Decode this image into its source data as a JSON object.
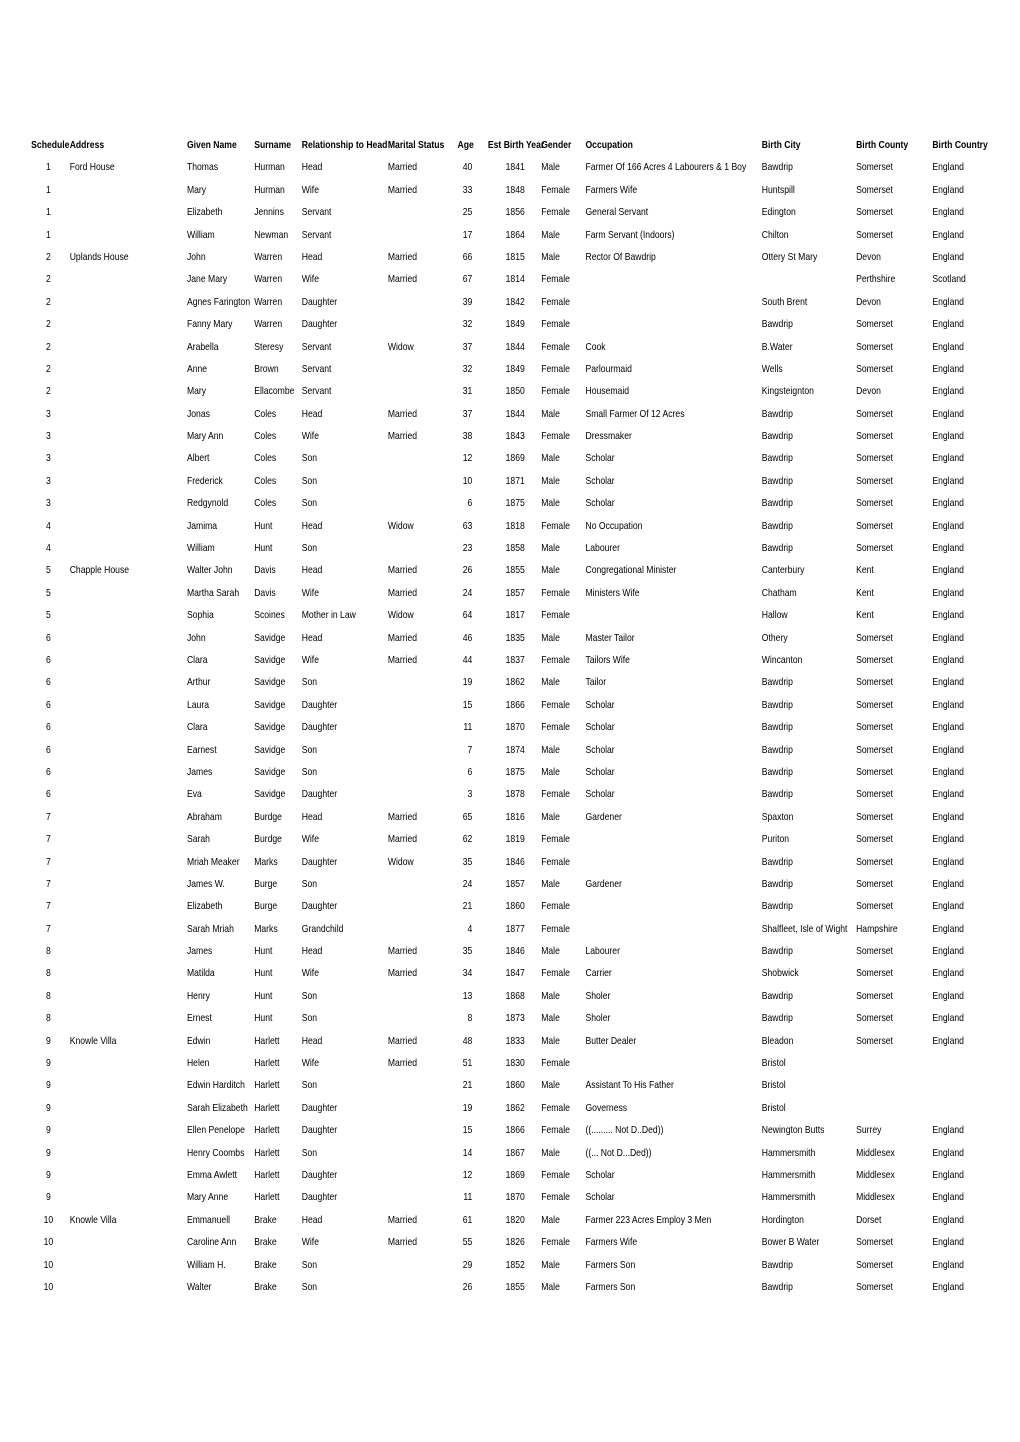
{
  "table": {
    "headers": [
      "Schedule",
      "Address",
      "Given Name",
      "Surname",
      "Relationship to Head",
      "Marital Status",
      "Age",
      "Est Birth Year",
      "Gender",
      "Occupation",
      "Birth City",
      "Birth County",
      "Birth Country"
    ],
    "rows": [
      [
        "1",
        "Ford House",
        "Thomas",
        "Hurman",
        "Head",
        "Married",
        "40",
        "1841",
        "Male",
        "Farmer Of 166 Acres 4 Labourers & 1 Boy",
        "Bawdrip",
        "Somerset",
        "England"
      ],
      [
        "1",
        "",
        "Mary",
        "Hurman",
        "Wife",
        "Married",
        "33",
        "1848",
        "Female",
        "Farmers Wife",
        "Huntspill",
        "Somerset",
        "England"
      ],
      [
        "1",
        "",
        "Elizabeth",
        "Jennins",
        "Servant",
        "",
        "25",
        "1856",
        "Female",
        "General Servant",
        "Edington",
        "Somerset",
        "England"
      ],
      [
        "1",
        "",
        "William",
        "Newman",
        "Servant",
        "",
        "17",
        "1864",
        "Male",
        "Farm Servant (Indoors)",
        "Chilton",
        "Somerset",
        "England"
      ],
      [
        "2",
        "Uplands House",
        "John",
        "Warren",
        "Head",
        "Married",
        "66",
        "1815",
        "Male",
        "Rector Of Bawdrip",
        "Ottery St Mary",
        "Devon",
        "England"
      ],
      [
        "2",
        "",
        "Jane Mary",
        "Warren",
        "Wife",
        "Married",
        "67",
        "1814",
        "Female",
        "",
        "",
        "Perthshire",
        "Scotland"
      ],
      [
        "2",
        "",
        "Agnes Farington",
        "Warren",
        "Daughter",
        "",
        "39",
        "1842",
        "Female",
        "",
        "South Brent",
        "Devon",
        "England"
      ],
      [
        "2",
        "",
        "Fanny Mary",
        "Warren",
        "Daughter",
        "",
        "32",
        "1849",
        "Female",
        "",
        "Bawdrip",
        "Somerset",
        "England"
      ],
      [
        "2",
        "",
        "Arabella",
        "Steresy",
        "Servant",
        "Widow",
        "37",
        "1844",
        "Female",
        "Cook",
        "B.Water",
        "Somerset",
        "England"
      ],
      [
        "2",
        "",
        "Anne",
        "Brown",
        "Servant",
        "",
        "32",
        "1849",
        "Female",
        "Parlourmaid",
        "Wells",
        "Somerset",
        "England"
      ],
      [
        "2",
        "",
        "Mary",
        "Ellacombe",
        "Servant",
        "",
        "31",
        "1850",
        "Female",
        "Housemaid",
        "Kingsteignton",
        "Devon",
        "England"
      ],
      [
        "3",
        "",
        "Jonas",
        "Coles",
        "Head",
        "Married",
        "37",
        "1844",
        "Male",
        "Small Farmer Of 12 Acres",
        "Bawdrip",
        "Somerset",
        "England"
      ],
      [
        "3",
        "",
        "Mary Ann",
        "Coles",
        "Wife",
        "Married",
        "38",
        "1843",
        "Female",
        "Dressmaker",
        "Bawdrip",
        "Somerset",
        "England"
      ],
      [
        "3",
        "",
        "Albert",
        "Coles",
        "Son",
        "",
        "12",
        "1869",
        "Male",
        "Scholar",
        "Bawdrip",
        "Somerset",
        "England"
      ],
      [
        "3",
        "",
        "Frederick",
        "Coles",
        "Son",
        "",
        "10",
        "1871",
        "Male",
        "Scholar",
        "Bawdrip",
        "Somerset",
        "England"
      ],
      [
        "3",
        "",
        "Redgynold",
        "Coles",
        "Son",
        "",
        "6",
        "1875",
        "Male",
        "Scholar",
        "Bawdrip",
        "Somerset",
        "England"
      ],
      [
        "4",
        "",
        "Jamima",
        "Hunt",
        "Head",
        "Widow",
        "63",
        "1818",
        "Female",
        "No Occupation",
        "Bawdrip",
        "Somerset",
        "England"
      ],
      [
        "4",
        "",
        "William",
        "Hunt",
        "Son",
        "",
        "23",
        "1858",
        "Male",
        "Labourer",
        "Bawdrip",
        "Somerset",
        "England"
      ],
      [
        "5",
        "Chapple House",
        "Walter John",
        "Davis",
        "Head",
        "Married",
        "26",
        "1855",
        "Male",
        "Congregational Minister",
        "Canterbury",
        "Kent",
        "England"
      ],
      [
        "5",
        "",
        "Martha Sarah",
        "Davis",
        "Wife",
        "Married",
        "24",
        "1857",
        "Female",
        "Ministers Wife",
        "Chatham",
        "Kent",
        "England"
      ],
      [
        "5",
        "",
        "Sophia",
        "Scoines",
        "Mother in Law",
        "Widow",
        "64",
        "1817",
        "Female",
        "",
        "Hallow",
        "Kent",
        "England"
      ],
      [
        "6",
        "",
        "John",
        "Savidge",
        "Head",
        "Married",
        "46",
        "1835",
        "Male",
        "Master Tailor",
        "Othery",
        "Somerset",
        "England"
      ],
      [
        "6",
        "",
        "Clara",
        "Savidge",
        "Wife",
        "Married",
        "44",
        "1837",
        "Female",
        "Tailors Wife",
        "Wincanton",
        "Somerset",
        "England"
      ],
      [
        "6",
        "",
        "Arthur",
        "Savidge",
        "Son",
        "",
        "19",
        "1862",
        "Male",
        "Tailor",
        "Bawdrip",
        "Somerset",
        "England"
      ],
      [
        "6",
        "",
        "Laura",
        "Savidge",
        "Daughter",
        "",
        "15",
        "1866",
        "Female",
        "Scholar",
        "Bawdrip",
        "Somerset",
        "England"
      ],
      [
        "6",
        "",
        "Clara",
        "Savidge",
        "Daughter",
        "",
        "11",
        "1870",
        "Female",
        "Scholar",
        "Bawdrip",
        "Somerset",
        "England"
      ],
      [
        "6",
        "",
        "Earnest",
        "Savidge",
        "Son",
        "",
        "7",
        "1874",
        "Male",
        "Scholar",
        "Bawdrip",
        "Somerset",
        "England"
      ],
      [
        "6",
        "",
        "James",
        "Savidge",
        "Son",
        "",
        "6",
        "1875",
        "Male",
        "Scholar",
        "Bawdrip",
        "Somerset",
        "England"
      ],
      [
        "6",
        "",
        "Eva",
        "Savidge",
        "Daughter",
        "",
        "3",
        "1878",
        "Female",
        "Scholar",
        "Bawdrip",
        "Somerset",
        "England"
      ],
      [
        "7",
        "",
        "Abraham",
        "Burdge",
        "Head",
        "Married",
        "65",
        "1816",
        "Male",
        "Gardener",
        "Spaxton",
        "Somerset",
        "England"
      ],
      [
        "7",
        "",
        "Sarah",
        "Burdge",
        "Wife",
        "Married",
        "62",
        "1819",
        "Female",
        "",
        "Puriton",
        "Somerset",
        "England"
      ],
      [
        "7",
        "",
        "Mriah Meaker",
        "Marks",
        "Daughter",
        "Widow",
        "35",
        "1846",
        "Female",
        "",
        "Bawdrip",
        "Somerset",
        "England"
      ],
      [
        "7",
        "",
        "James W.",
        "Burge",
        "Son",
        "",
        "24",
        "1857",
        "Male",
        "Gardener",
        "Bawdrip",
        "Somerset",
        "England"
      ],
      [
        "7",
        "",
        "Elizabeth",
        "Burge",
        "Daughter",
        "",
        "21",
        "1860",
        "Female",
        "",
        "Bawdrip",
        "Somerset",
        "England"
      ],
      [
        "7",
        "",
        "Sarah Mriah",
        "Marks",
        "Grandchild",
        "",
        "4",
        "1877",
        "Female",
        "",
        "Shalfleet, Isle of Wight",
        "Hampshire",
        "England"
      ],
      [
        "8",
        "",
        "James",
        "Hunt",
        "Head",
        "Married",
        "35",
        "1846",
        "Male",
        "Labourer",
        "Bawdrip",
        "Somerset",
        "England"
      ],
      [
        "8",
        "",
        "Matilda",
        "Hunt",
        "Wife",
        "Married",
        "34",
        "1847",
        "Female",
        "Carrier",
        "Shobwick",
        "Somerset",
        "England"
      ],
      [
        "8",
        "",
        "Henry",
        "Hunt",
        "Son",
        "",
        "13",
        "1868",
        "Male",
        "Sholer",
        "Bawdrip",
        "Somerset",
        "England"
      ],
      [
        "8",
        "",
        "Ernest",
        "Hunt",
        "Son",
        "",
        "8",
        "1873",
        "Male",
        "Sholer",
        "Bawdrip",
        "Somerset",
        "England"
      ],
      [
        "9",
        "Knowle Villa",
        "Edwin",
        "Harlett",
        "Head",
        "Married",
        "48",
        "1833",
        "Male",
        "Butter Dealer",
        "Bleadon",
        "Somerset",
        "England"
      ],
      [
        "9",
        "",
        "Helen",
        "Harlett",
        "Wife",
        "Married",
        "51",
        "1830",
        "Female",
        "",
        "Bristol",
        "",
        ""
      ],
      [
        "9",
        "",
        "Edwin Harditch",
        "Harlett",
        "Son",
        "",
        "21",
        "1860",
        "Male",
        "Assistant To His Father",
        "Bristol",
        "",
        ""
      ],
      [
        "9",
        "",
        "Sarah Elizabeth",
        "Harlett",
        "Daughter",
        "",
        "19",
        "1862",
        "Female",
        "Governess",
        "Bristol",
        "",
        ""
      ],
      [
        "9",
        "",
        "Ellen Penelope",
        "Harlett",
        "Daughter",
        "",
        "15",
        "1866",
        "Female",
        "((......... Not D..Ded))",
        "Newington Butts",
        "Surrey",
        "England"
      ],
      [
        "9",
        "",
        "Henry Coombs",
        "Harlett",
        "Son",
        "",
        "14",
        "1867",
        "Male",
        "((... Not D...Ded))",
        "Hammersmith",
        "Middlesex",
        "England"
      ],
      [
        "9",
        "",
        "Emma Awlett",
        "Harlett",
        "Daughter",
        "",
        "12",
        "1869",
        "Female",
        "Scholar",
        "Hammersmith",
        "Middlesex",
        "England"
      ],
      [
        "9",
        "",
        "Mary Anne",
        "Harlett",
        "Daughter",
        "",
        "11",
        "1870",
        "Female",
        "Scholar",
        "Hammersmith",
        "Middlesex",
        "England"
      ],
      [
        "10",
        "Knowle Villa",
        "Emmanuell",
        "Brake",
        "Head",
        "Married",
        "61",
        "1820",
        "Male",
        "Farmer 223 Acres Employ 3 Men",
        "Hordington",
        "Dorset",
        "England"
      ],
      [
        "10",
        "",
        "Caroline Ann",
        "Brake",
        "Wife",
        "Married",
        "55",
        "1826",
        "Female",
        "Farmers Wife",
        "Bower B Water",
        "Somerset",
        "England"
      ],
      [
        "10",
        "",
        "William H.",
        "Brake",
        "Son",
        "",
        "29",
        "1852",
        "Male",
        "Farmers Son",
        "Bawdrip",
        "Somerset",
        "England"
      ],
      [
        "10",
        "",
        "Walter",
        "Brake",
        "Son",
        "",
        "26",
        "1855",
        "Male",
        "Farmers Son",
        "Bawdrip",
        "Somerset",
        "England"
      ]
    ]
  }
}
